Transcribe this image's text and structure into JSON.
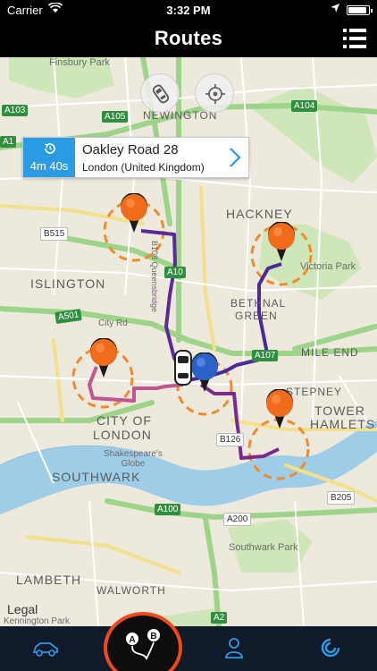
{
  "status_bar": {
    "carrier": "Carrier",
    "time": "3:32 PM",
    "battery_level": 0.9
  },
  "nav": {
    "title": "Routes",
    "menu_icon": "list-menu-icon"
  },
  "map": {
    "area_labels": {
      "finsbury_park": "Finsbury Park",
      "newington": "NEWINGTON",
      "hackney": "HACKNEY",
      "victoria_park": "Victoria Park",
      "islington": "ISLINGTON",
      "bethnal_green_1": "BETHNAL",
      "bethnal_green_2": "GREEN",
      "mile_end": "MILE END",
      "stepney": "STEPNEY",
      "tower_hamlets_1": "TOWER",
      "tower_hamlets_2": "HAMLETS",
      "city_of_london_1": "CITY OF",
      "city_of_london_2": "LONDON",
      "shakespeares_globe": "Shakespeare's\nGlobe",
      "southwark": "SOUTHWARK",
      "southwark_park": "Southwark Park",
      "lambeth": "LAMBETH",
      "walworth": "WALWORTH",
      "city_rd": "City Rd",
      "queensbridge": "B108 Queensbridge",
      "kennington_park": "Kennington Park"
    },
    "road_badges": {
      "a103": "A103",
      "a105": "A105",
      "a104": "A104",
      "a1": "A1",
      "b515": "B515",
      "a10": "A10",
      "a501": "A501",
      "a107": "A107",
      "b126": "B126",
      "b205": "B205",
      "a100": "A100",
      "a200": "A200",
      "a2": "A2"
    },
    "buttons": {
      "vehicle": "car-front-icon",
      "locate": "crosshair-icon"
    },
    "callout": {
      "eta": "4m 40s",
      "name": "Oakley Road 28",
      "place": "London (United Kingdom)"
    },
    "legal": "Legal",
    "colors": {
      "route_purple": "#5b2a9a",
      "route_pink": "#c0568f",
      "pin_orange": "#f06c1c",
      "pin_blue": "#2a62c9",
      "eta_blue": "#2b9be6"
    }
  },
  "tabs": [
    {
      "name": "vehicle-tab",
      "icon": "car-icon"
    },
    {
      "name": "routes-tab",
      "icon": "route-ab-icon",
      "active": true
    },
    {
      "name": "profile-tab",
      "icon": "person-icon"
    },
    {
      "name": "about-tab",
      "icon": "swirl-logo-icon"
    }
  ]
}
